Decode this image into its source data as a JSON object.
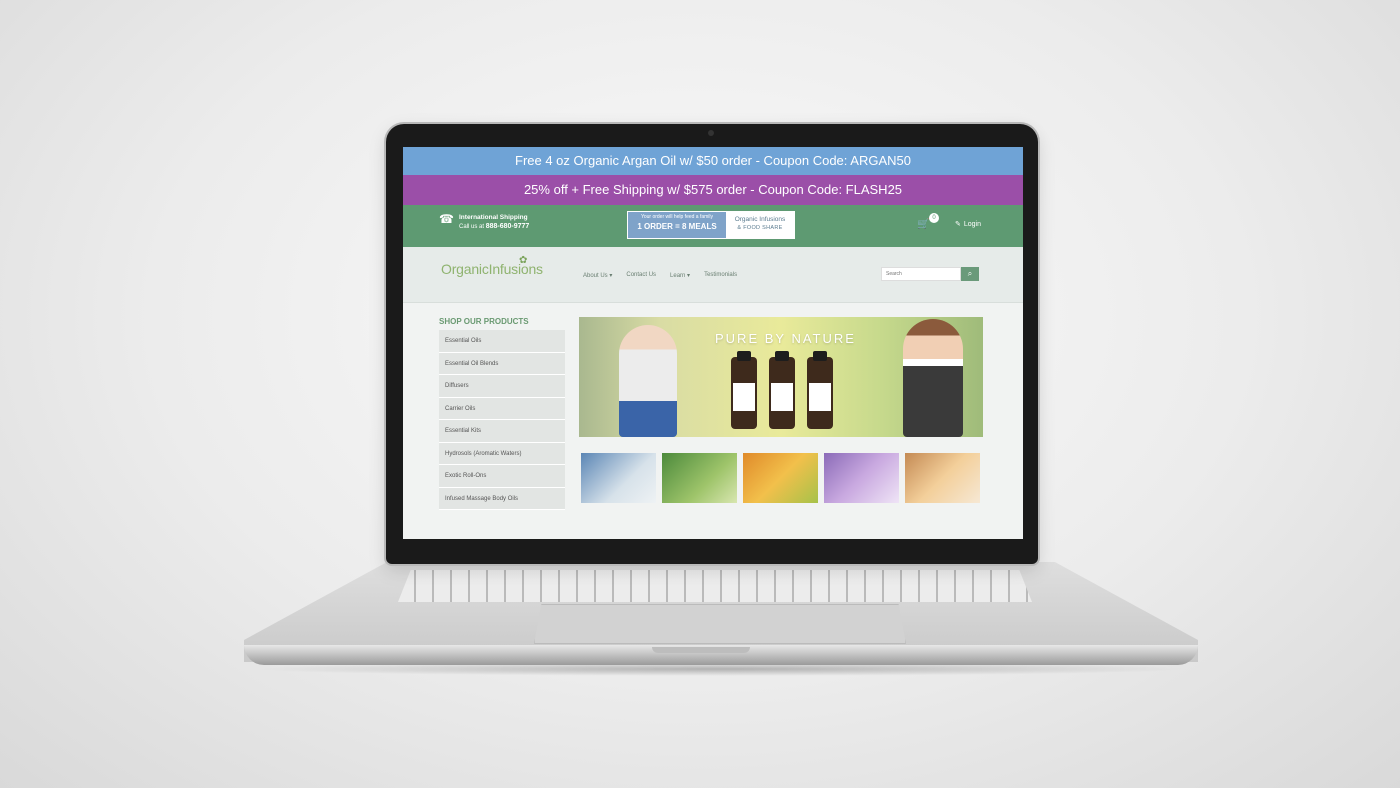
{
  "banners": {
    "top": "Free 4 oz Organic Argan Oil w/ $50 order - Coupon Code: ARGAN50",
    "second": "25% off + Free Shipping w/ $575 order - Coupon Code: FLASH25"
  },
  "header": {
    "shipping_title": "International Shipping",
    "call_prefix": "Call us at",
    "phone": "888-680-9777",
    "promo_small": "Your order will help feed a family",
    "promo_big": "1 ORDER = 8 MEALS",
    "promo_brand": "Organic Infusions",
    "promo_brand2": "& FOOD SHARE",
    "cart_count": "0",
    "login_label": "Login"
  },
  "nav": {
    "logo_main": "Organic",
    "logo_accent": "Infusions",
    "links": [
      "About Us ▾",
      "Contact Us",
      "Learn ▾",
      "Testimonials"
    ],
    "search_placeholder": "Search"
  },
  "sidebar": {
    "title": "SHOP OUR PRODUCTS",
    "items": [
      "Essential Oils",
      "Essential Oil Blends",
      "Diffusers",
      "Carrier Oils",
      "Essential Kits",
      "Hydrosols (Aromatic Waters)",
      "Exotic Roll-Ons",
      "Infused Massage Body Oils"
    ]
  },
  "hero": {
    "title": "PURE BY NATURE"
  },
  "colors": {
    "banner_blue": "#6fa3d6",
    "banner_purple": "#9b4fa8",
    "header_green": "#5e9a72"
  }
}
